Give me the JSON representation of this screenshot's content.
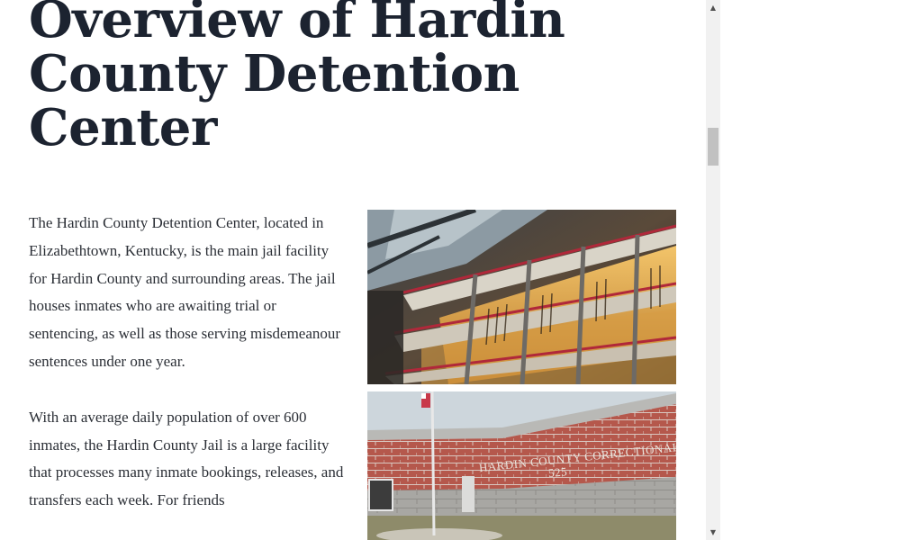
{
  "article": {
    "title": "Overview of Hardin County Detention Center",
    "paragraphs": [
      "The Hardin County Detention Center, located in Elizabethtown, Kentucky, is the main jail facility for Hardin County and surrounding areas. The jail houses inmates who are awaiting trial or sentencing, as well as those serving misdemeanour sentences under one year.",
      "With an average daily population of over 600 inmates, the Hardin County Jail is a large facility that processes many inmate bookings, releases, and transfers each week. For friends"
    ],
    "images": {
      "cellblock": {
        "icon": "jail-cellblock-photo"
      },
      "exterior": {
        "icon": "correctional-facility-exterior-photo",
        "sign_text": "HARDIN COUNTY CORRECTIONAL FACILITY",
        "sign_number": "525"
      }
    }
  },
  "scrollbar": {
    "up_arrow": "▲",
    "down_arrow": "▼"
  },
  "colors": {
    "title": "#1c2330",
    "body_text": "#2b2f36",
    "scrollbar_track": "#f1f1f1",
    "scrollbar_thumb": "#c1c1c1"
  }
}
